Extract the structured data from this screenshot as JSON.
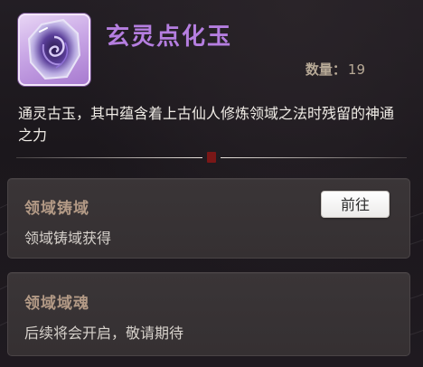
{
  "item": {
    "name": "玄灵点化玉",
    "icon": "purple-jade-stone-icon",
    "quantity_label": "数量：",
    "quantity_value": "19",
    "description": "通灵古玉，其中蕴含着上古仙人修炼领域之法时残留的神通之力"
  },
  "sources": [
    {
      "title": "领域铸域",
      "description": "领域铸域获得",
      "button_label": "前往"
    },
    {
      "title": "领域域魂",
      "description": "后续将会开启，敬请期待"
    }
  ],
  "colors": {
    "title": "#b57ee0",
    "card_title": "#b39a86",
    "background": "#1c181d",
    "seal": "#7a1717"
  }
}
